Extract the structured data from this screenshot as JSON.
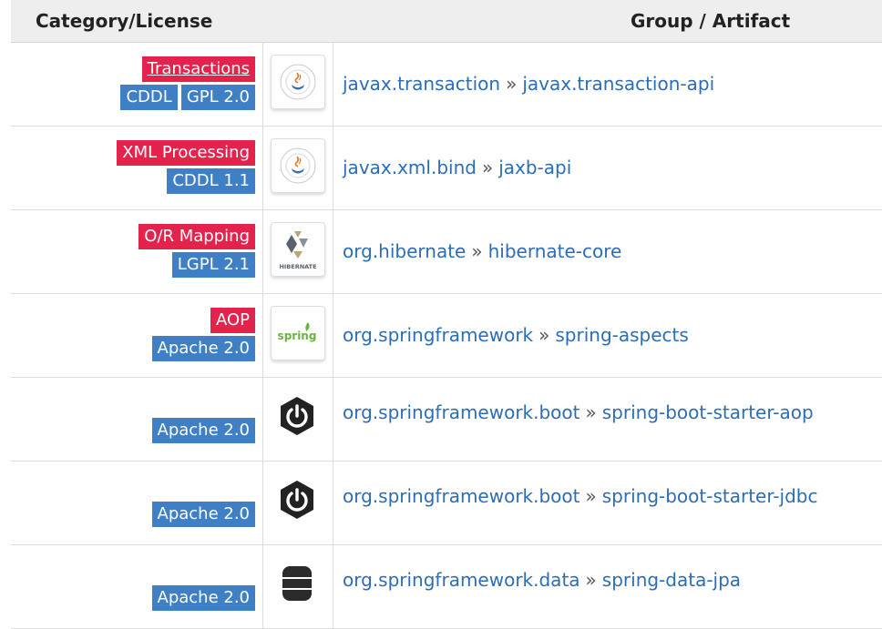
{
  "headers": {
    "category": "Category/License",
    "group": "Group / Artifact"
  },
  "separator": "»",
  "rows": [
    {
      "categories": [
        "Transactions"
      ],
      "licenses": [
        "CDDL",
        "GPL 2.0"
      ],
      "icon": "java-coffee-seal-icon",
      "group": "javax.transaction",
      "artifact": "javax.transaction-api"
    },
    {
      "categories": [
        "XML Processing"
      ],
      "licenses": [
        "CDDL 1.1"
      ],
      "icon": "java-coffee-seal-icon",
      "group": "javax.xml.bind",
      "artifact": "jaxb-api"
    },
    {
      "categories": [
        "O/R Mapping"
      ],
      "licenses": [
        "LGPL 2.1"
      ],
      "icon": "hibernate-logo-icon",
      "icon_text": "HIBERNATE",
      "group": "org.hibernate",
      "artifact": "hibernate-core"
    },
    {
      "categories": [
        "AOP"
      ],
      "licenses": [
        "Apache 2.0"
      ],
      "icon": "spring-logo-icon",
      "icon_text": "spring",
      "group": "org.springframework",
      "artifact": "spring-aspects"
    },
    {
      "categories": [],
      "licenses": [
        "Apache 2.0"
      ],
      "icon": "spring-boot-power-icon",
      "group": "org.springframework.boot",
      "artifact": "spring-boot-starter-aop"
    },
    {
      "categories": [],
      "licenses": [
        "Apache 2.0"
      ],
      "icon": "spring-boot-power-icon",
      "group": "org.springframework.boot",
      "artifact": "spring-boot-starter-jdbc"
    },
    {
      "categories": [],
      "licenses": [
        "Apache 2.0"
      ],
      "icon": "database-icon",
      "group": "org.springframework.data",
      "artifact": "spring-data-jpa"
    }
  ],
  "colors": {
    "category_badge": "#e3234b",
    "license_badge": "#3f7fc6",
    "link": "#2c6db5",
    "header_bg": "#eeeeee"
  }
}
